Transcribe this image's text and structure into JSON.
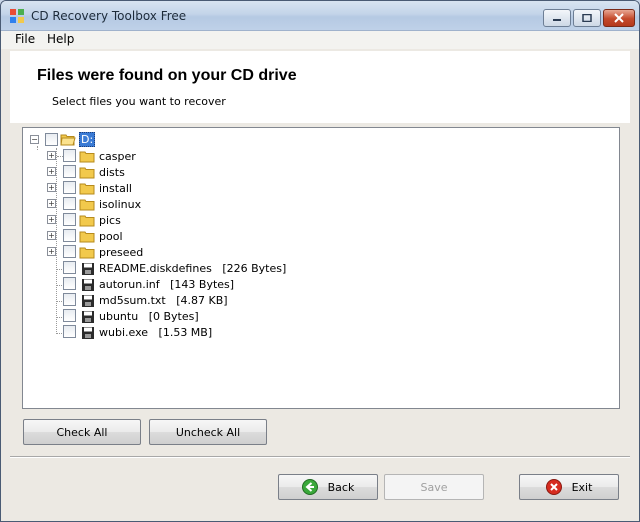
{
  "window": {
    "title": "CD Recovery Toolbox Free"
  },
  "menu": {
    "file": "File",
    "help": "Help"
  },
  "header": {
    "title": "Files were found on your CD drive",
    "subtitle": "Select files you want to recover"
  },
  "tree": {
    "root": {
      "label": "D:"
    },
    "folders": [
      "casper",
      "dists",
      "install",
      "isolinux",
      "pics",
      "pool",
      "preseed"
    ],
    "files": [
      {
        "name": "README.diskdefines",
        "size": "[226 Bytes]"
      },
      {
        "name": "autorun.inf",
        "size": "[143 Bytes]"
      },
      {
        "name": "md5sum.txt",
        "size": "[4.87 KB]"
      },
      {
        "name": "ubuntu",
        "size": "[0 Bytes]"
      },
      {
        "name": "wubi.exe",
        "size": "[1.53 MB]"
      }
    ]
  },
  "buttons": {
    "check_all": "Check All",
    "uncheck_all": "Uncheck All",
    "back": "Back",
    "save": "Save",
    "exit": "Exit"
  },
  "colors": {
    "selection": "#3a7bd5",
    "folder": "#f2c94c",
    "back_icon": "#3aa83a",
    "exit_icon": "#d62b1f"
  }
}
